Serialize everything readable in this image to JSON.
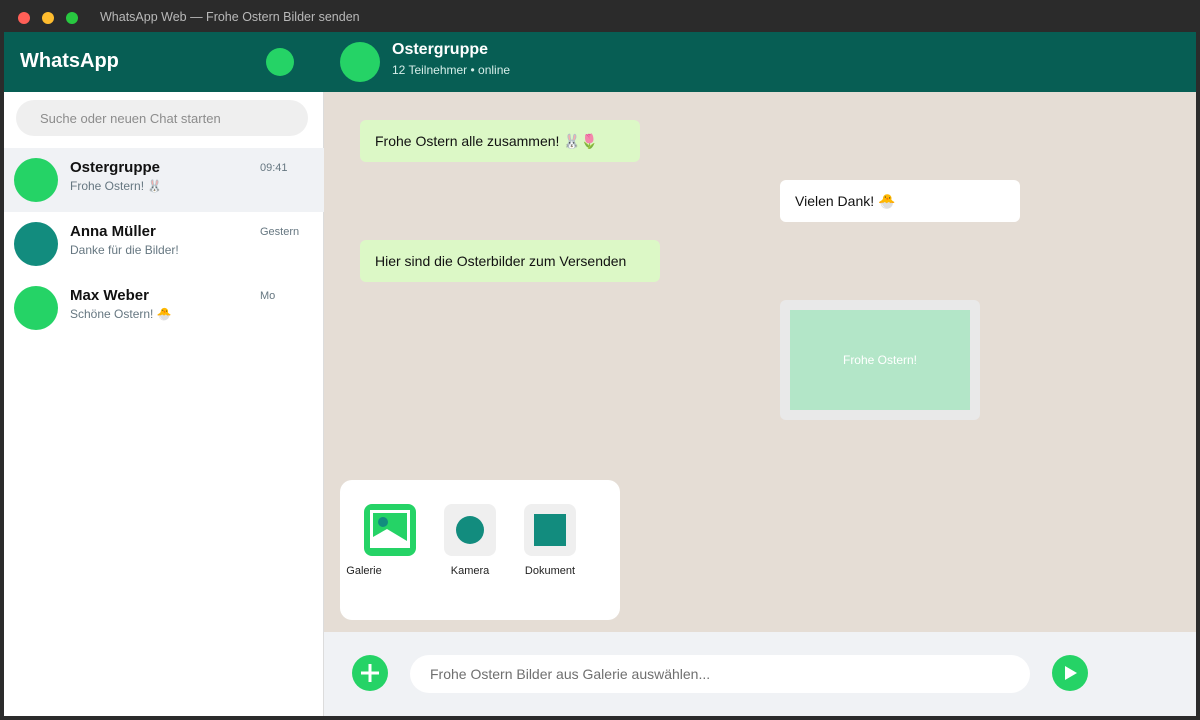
{
  "window": {
    "title": "WhatsApp Web — Frohe Ostern Bilder senden"
  },
  "sidebar": {
    "app_name": "WhatsApp",
    "search": {
      "placeholder": "Suche oder neuen Chat starten"
    },
    "chats": [
      {
        "name": "Ostergruppe",
        "time": "09:41",
        "preview": "Frohe Ostern! 🐰",
        "avatar_color": "#25d366",
        "active": true
      },
      {
        "name": "Anna Müller",
        "time": "Gestern",
        "preview": "Danke für die Bilder!",
        "avatar_color": "#128c7e",
        "active": false
      },
      {
        "name": "Max Weber",
        "time": "Mo",
        "preview": "Schöne Ostern! 🐣",
        "avatar_color": "#25d366",
        "active": false
      }
    ]
  },
  "chat": {
    "name": "Ostergruppe",
    "status": "12 Teilnehmer • online",
    "messages": [
      {
        "text": "Frohe Ostern alle zusammen! 🐰🌷",
        "direction": "in"
      },
      {
        "text": "Vielen Dank! 🐣",
        "direction": "out"
      },
      {
        "text": "Hier sind die Osterbilder zum Versenden",
        "direction": "in"
      }
    ],
    "image_message": {
      "caption": "Frohe Ostern!"
    }
  },
  "attach_menu": {
    "options": [
      {
        "label": "Galerie",
        "icon": "gallery-icon"
      },
      {
        "label": "Kamera",
        "icon": "camera-icon"
      },
      {
        "label": "Dokument",
        "icon": "document-icon"
      }
    ]
  },
  "composer": {
    "placeholder": "Frohe Ostern Bilder aus Galerie auswählen...",
    "value": "",
    "plus_icon": "plus-icon",
    "send_icon": "send-icon"
  },
  "colors": {
    "header": "#075e54",
    "accent": "#25d366",
    "teal": "#128c7e",
    "incoming_bubble": "#dcf8c6",
    "chat_background": "#e5ddd5"
  }
}
